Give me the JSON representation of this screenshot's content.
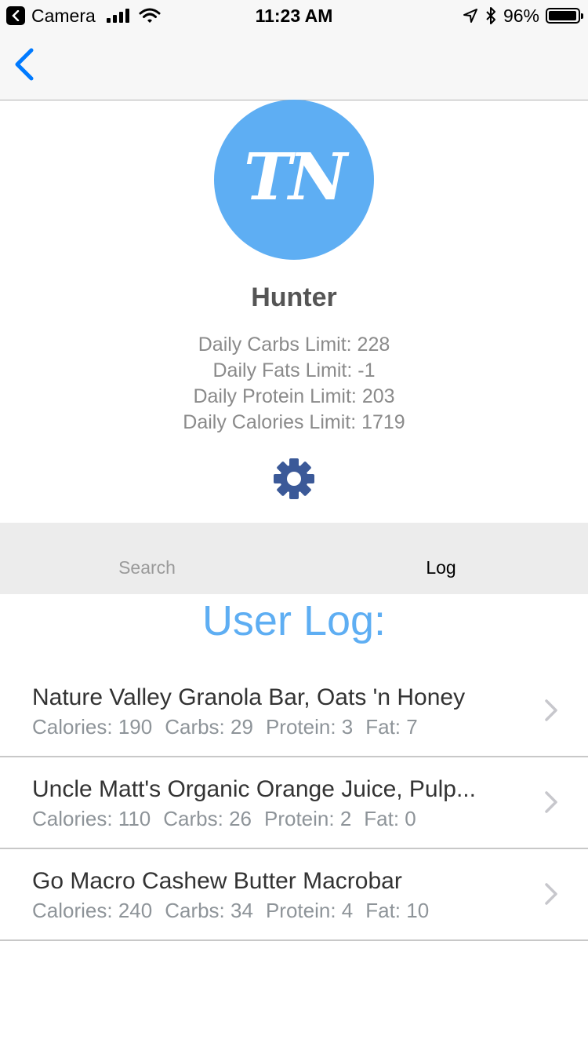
{
  "status_bar": {
    "back_app": "Camera",
    "time": "11:23 AM",
    "battery": "96%",
    "battery_level": 0.96
  },
  "nav": {
    "back_icon": "chevron-left-icon"
  },
  "profile": {
    "initials": "TN",
    "avatar_color": "#5eaef3",
    "name": "Hunter",
    "limits": [
      "Daily Carbs Limit: 228",
      "Daily Fats Limit: -1",
      "Daily Protein Limit: 203",
      "Daily Calories Limit: 1719"
    ],
    "settings_icon": "gear-icon",
    "settings_color": "#3b5998"
  },
  "tabs": [
    {
      "label": "Search",
      "active": false
    },
    {
      "label": "Log",
      "active": true
    }
  ],
  "log": {
    "title": "User Log:",
    "items": [
      {
        "name": "Nature Valley Granola Bar, Oats 'n Honey",
        "calories": "Calories: 190",
        "carbs": "Carbs: 29",
        "protein": "Protein: 3",
        "fat": "Fat: 7"
      },
      {
        "name": "Uncle Matt's Organic Orange Juice, Pulp...",
        "calories": "Calories: 110",
        "carbs": "Carbs: 26",
        "protein": "Protein: 2",
        "fat": "Fat: 0"
      },
      {
        "name": "Go Macro Cashew Butter Macrobar",
        "calories": "Calories: 240",
        "carbs": "Carbs: 34",
        "protein": "Protein: 4",
        "fat": "Fat: 10"
      }
    ]
  },
  "colors": {
    "accent": "#007aff",
    "title_blue": "#5eaef3"
  }
}
